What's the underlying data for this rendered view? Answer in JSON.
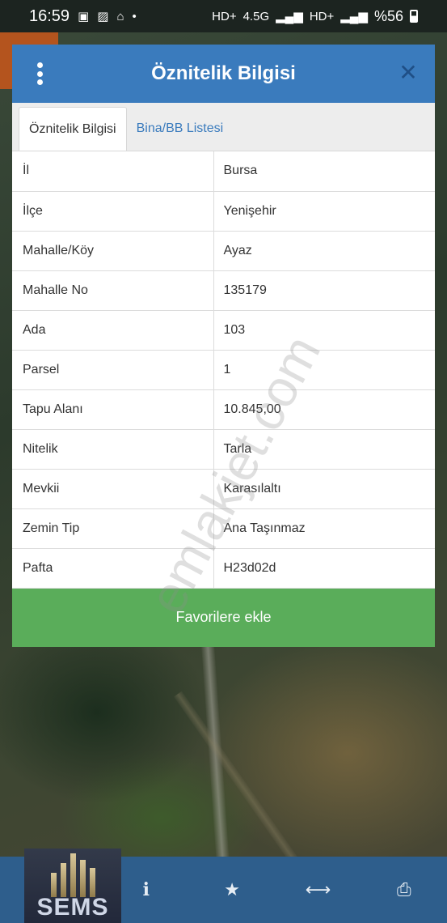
{
  "status_bar": {
    "time": "16:59",
    "battery": "%56",
    "network": "4.5G"
  },
  "dialog": {
    "title": "Öznitelik Bilgisi",
    "tabs": [
      {
        "label": "Öznitelik Bilgisi",
        "active": true
      },
      {
        "label": "Bina/BB Listesi",
        "active": false
      }
    ],
    "rows": [
      {
        "key": "İl",
        "value": "Bursa"
      },
      {
        "key": "İlçe",
        "value": "Yenişehir"
      },
      {
        "key": "Mahalle/Köy",
        "value": "Ayaz"
      },
      {
        "key": "Mahalle No",
        "value": "135179"
      },
      {
        "key": "Ada",
        "value": "103"
      },
      {
        "key": "Parsel",
        "value": "1"
      },
      {
        "key": "Tapu Alanı",
        "value": "10.845,00"
      },
      {
        "key": "Nitelik",
        "value": "Tarla"
      },
      {
        "key": "Mevkii",
        "value": "Karasılaltı"
      },
      {
        "key": "Zemin Tip",
        "value": "Ana Taşınmaz"
      },
      {
        "key": "Pafta",
        "value": "H23d02d"
      }
    ],
    "favorite_button": "Favorilere ekle"
  },
  "watermark": "emlakjet.com",
  "logo_text": "SEMS",
  "bottom_bar": {
    "items": [
      {
        "icon": "info-icon",
        "glyph": "i"
      },
      {
        "icon": "star-icon",
        "glyph": "★"
      },
      {
        "icon": "arrows-icon",
        "glyph": "⟷"
      },
      {
        "icon": "print-icon",
        "glyph": "⎙"
      }
    ]
  },
  "colors": {
    "header": "#3a7bbd",
    "button": "#5aad5a",
    "bottom_bar": "#2e5e8c"
  }
}
